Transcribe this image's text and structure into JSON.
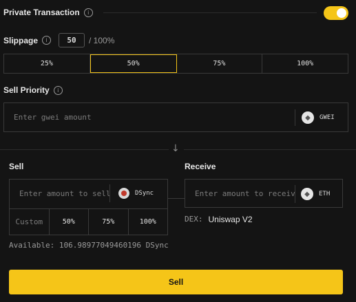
{
  "private_tx": {
    "label": "Private Transaction",
    "enabled": true
  },
  "slippage": {
    "label": "Slippage",
    "value": "50",
    "suffix": "/ 100%"
  },
  "slippage_options": [
    "25%",
    "50%",
    "75%",
    "100%"
  ],
  "slippage_selected": "50%",
  "sell_priority": {
    "label": "Sell Priority",
    "placeholder": "Enter gwei amount",
    "unit": "GWEI"
  },
  "sell": {
    "label": "Sell",
    "placeholder": "Enter amount to sell",
    "token": "DSync",
    "percent_options": [
      "Custom",
      "50%",
      "75%",
      "100%"
    ],
    "available": "Available: 106.98977049460196 DSync"
  },
  "receive": {
    "label": "Receive",
    "placeholder": "Enter amount to receiv",
    "token": "ETH",
    "dex_label": "DEX:",
    "dex_value": "Uniswap V2"
  },
  "sell_button": "Sell",
  "colors": {
    "accent": "#f5c518",
    "background": "#141414",
    "border": "#3a3a3a"
  }
}
